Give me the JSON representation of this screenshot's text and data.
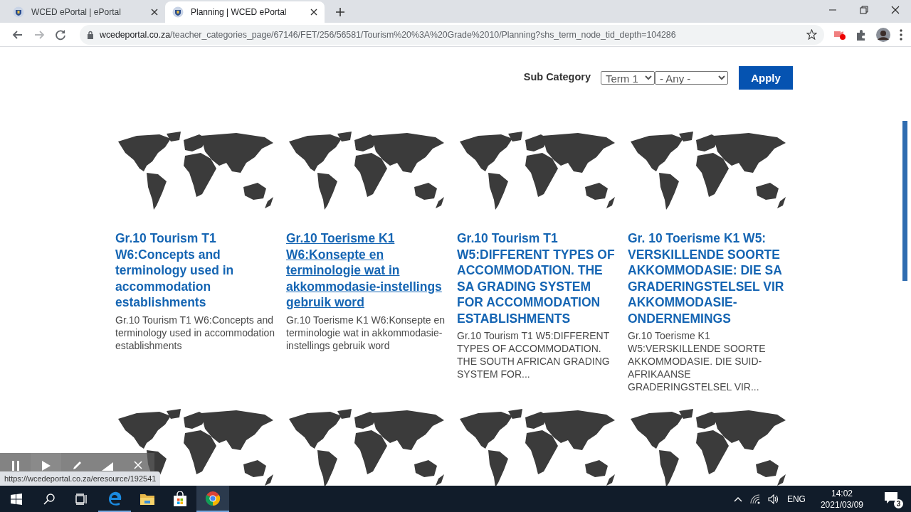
{
  "browser": {
    "tabs": [
      {
        "title": "WCED ePortal | ePortal",
        "selected": false
      },
      {
        "title": "Planning | WCED ePortal",
        "selected": true
      }
    ],
    "url_host": "wcedeportal.co.za",
    "url_path": "/teacher_categories_page/67146/FET/256/56581/Tourism%20%3A%20Grade%2010/Planning?shs_term_node_tid_depth=104286",
    "forward_disabled": true
  },
  "filter": {
    "label": "Sub Category",
    "selects": [
      {
        "value": "Term 1"
      },
      {
        "value": "- Any -"
      }
    ],
    "button": "Apply"
  },
  "resources": [
    {
      "kind": "card",
      "title": "Gr.10 Tourism T1 W6:Concepts and terminology used in accommodation establishments",
      "summary": "Gr.10 Tourism T1 W6:Concepts and terminology used in accommodation establishments",
      "hovered": false
    },
    {
      "kind": "card",
      "title": "Gr.10 Toerisme K1 W6:Konsepte en terminologie wat in akkommodasie-instellings gebruik word",
      "summary": "Gr.10 Toerisme K1 W6:Konsepte en terminologie wat in akkommodasie-instellings gebruik word",
      "hovered": true
    },
    {
      "kind": "card",
      "title": "Gr.10 Tourism T1 W5:DIFFERENT TYPES OF ACCOMMODATION. THE SA GRADING SYSTEM FOR ACCOMMODATION ESTABLISHMENTS",
      "summary": "Gr.10 Tourism T1 W5:DIFFERENT TYPES OF ACCOMMODATION. THE SOUTH AFRICAN GRADING SYSTEM FOR...",
      "hovered": false
    },
    {
      "kind": "card",
      "title": "Gr. 10 Toerisme K1 W5: VERSKILLENDE SOORTE AKKOMMODASIE: DIE SA GRADERINGSTELSEL VIR AKKOMMODASIE-ONDERNEMINGS",
      "summary": "Gr.10 Toerisme K1 W5:VERSKILLENDE SOORTE AKKOMMODASIE. DIE SUID-AFRIKAANSE GRADERINGSTELSEL VIR...",
      "hovered": false
    },
    {
      "kind": "image-only"
    },
    {
      "kind": "image-only"
    },
    {
      "kind": "image-only"
    },
    {
      "kind": "image-only"
    }
  ],
  "status_url": "https://wcedeportal.co.za/eresource/192541",
  "taskbar": {
    "apps": [
      {
        "kind": "edge",
        "running": true,
        "active": false
      },
      {
        "kind": "explorer",
        "running": false,
        "active": false
      },
      {
        "kind": "store",
        "running": false,
        "active": false
      },
      {
        "kind": "chrome",
        "running": true,
        "active": true
      }
    ],
    "language": "ENG",
    "time": "14:02",
    "date": "2021/03/09",
    "notifications": "3"
  }
}
